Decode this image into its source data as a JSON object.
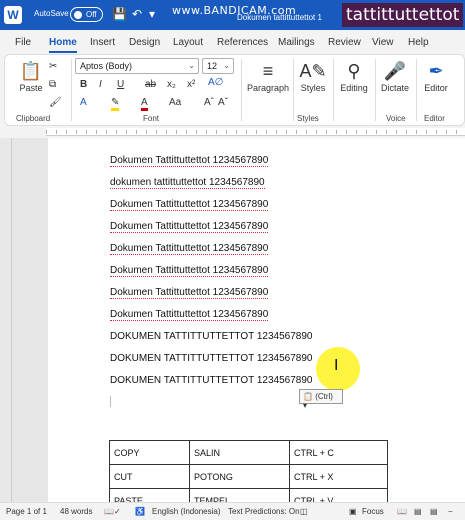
{
  "title_bar": {
    "app_logo": "W",
    "autosave_label": "AutoSave",
    "autosave_state": "Off",
    "watermark": "www.BANDICAM.com",
    "doc_title": "Dokumen tattittuttettot 1",
    "overlay_title": "tattittuttettot"
  },
  "tabs": [
    "File",
    "Home",
    "Insert",
    "Design",
    "Layout",
    "References",
    "Mailings",
    "Review",
    "View",
    "Help"
  ],
  "ribbon": {
    "clipboard": {
      "paste_label": "Paste",
      "group_label": "Clipboard"
    },
    "font": {
      "font_name": "Aptos (Body)",
      "font_size": "12",
      "group_label": "Font"
    },
    "paragraph": {
      "label": "Paragraph",
      "group_label": ""
    },
    "styles": {
      "label": "Styles",
      "group_label": "Styles"
    },
    "editing": {
      "label": "Editing"
    },
    "voice": {
      "label": "Dictate",
      "group_label": "Voice"
    },
    "editor": {
      "label": "Editor",
      "group_label": "Editor"
    }
  },
  "document": {
    "lines": [
      "Dokumen Tattittuttettot 1234567890",
      "dokumen tattittuttettot 1234567890",
      "Dokumen Tattittuttettot 1234567890",
      "Dokumen Tattittuttettot 1234567890",
      "Dokumen Tattittuttettot 1234567890",
      "Dokumen Tattittuttettot 1234567890",
      "Dokumen Tattittuttettot 1234567890",
      "Dokumen Tattittuttettot 1234567890",
      "DOKUMEN TATTITTUTTETTOT 1234567890",
      "DOKUMEN TATTITTUTTETTOT 1234567890",
      "DOKUMEN TATTITTUTTETTOT 1234567890"
    ],
    "paste_options": "(Ctrl)",
    "table": [
      [
        "COPY",
        "SALIN",
        "CTRL + C"
      ],
      [
        "CUT",
        "POTONG",
        "CTRL + X"
      ],
      [
        "PASTE",
        "TEMPEL",
        "CTRL + V"
      ]
    ]
  },
  "status_bar": {
    "page": "Page 1 of 1",
    "words": "48 words",
    "language": "English (Indonesia)",
    "text_predictions": "Text Predictions: On",
    "focus": "Focus"
  }
}
